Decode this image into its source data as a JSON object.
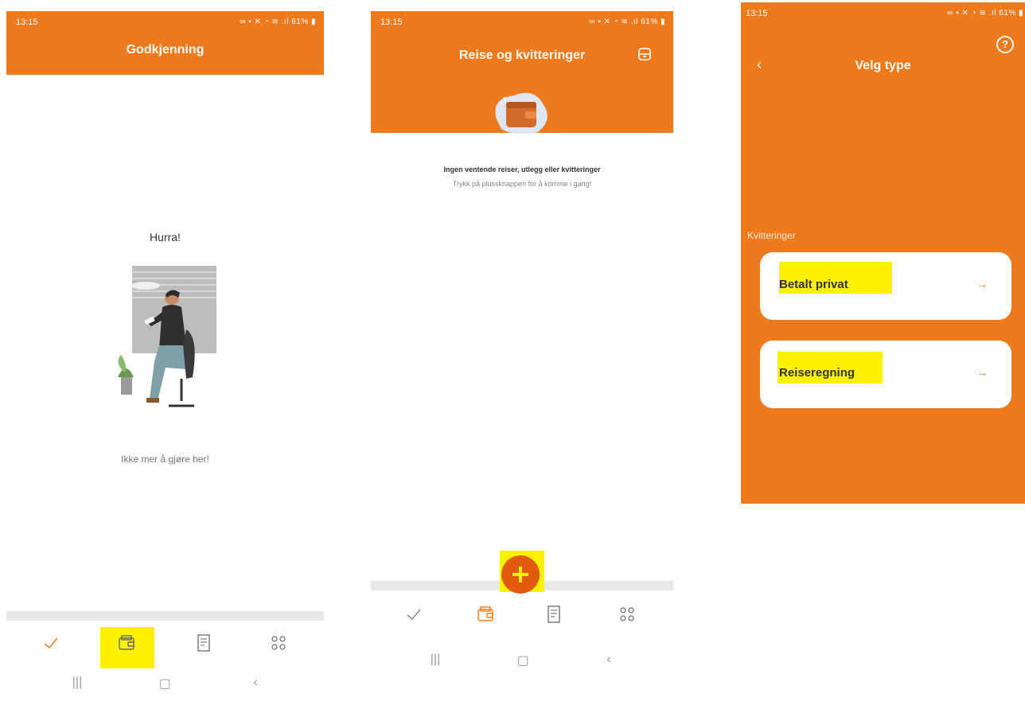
{
  "screen1": {
    "status_time": "13:15",
    "status_battery": "61%",
    "title": "Godkjenning",
    "heading": "Hurra!",
    "empty_message": "Ikke mer å gjøre her!",
    "tabs": [
      "check-icon",
      "wallet-icon",
      "receipt-icon",
      "apps-grid-icon"
    ],
    "active_tab": "check-icon",
    "highlighted_tab": "wallet-icon"
  },
  "screen2": {
    "status_time": "13:15",
    "status_battery": "61%",
    "title": "Reise og kvitteringer",
    "empty_title": "Ingen ventende reiser, utlegg eller kvitteringer",
    "empty_subtitle": "Trykk på plussknappen for å komme i gang!",
    "tabs": [
      "check-icon",
      "wallet-icon",
      "receipt-icon",
      "apps-grid-icon"
    ],
    "active_tab": "wallet-icon",
    "fab": "plus-icon"
  },
  "screen3": {
    "status_time": "13:15",
    "status_battery": "61%",
    "title": "Velg type",
    "section_label": "Kvitteringer",
    "options": [
      {
        "label": "Betalt privat"
      },
      {
        "label": "Reiseregning"
      }
    ]
  },
  "colors": {
    "brand": "#EE7A1D",
    "highlight": "#FFF200",
    "fab": "#E05A10"
  }
}
